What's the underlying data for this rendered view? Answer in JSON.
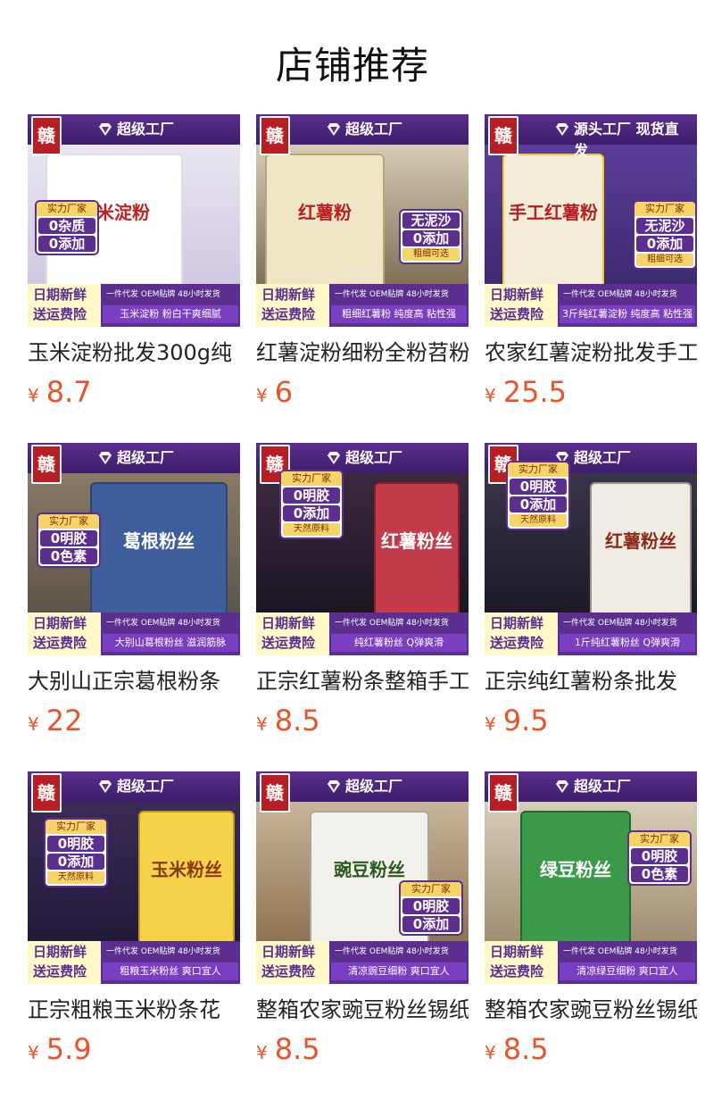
{
  "page": {
    "title": "店铺推荐"
  },
  "colors": {
    "accent": "#5b2e8f",
    "price": "#e8542a",
    "banner_yellow": "#f7d46a"
  },
  "common": {
    "factory_label": "超级工厂",
    "logo_text": "赣",
    "bottom_left_line1": "日期新鲜",
    "bottom_left_line2": "送运费险",
    "bottom_right_top": "一件代发 OEM贴牌 48小时发货",
    "currency": "¥"
  },
  "products": [
    {
      "title": "玉米淀粉批发300g纯",
      "price": "8.7",
      "tagline": "玉米淀粉 粉白干爽细腻",
      "badge_top": "实力厂家",
      "badge_lines": [
        "0杂质",
        "0添加"
      ],
      "badge_sub": "",
      "pkg_text": "玉米淀粉",
      "factory_label_override": ""
    },
    {
      "title": "红薯淀粉细粉全粉苕粉",
      "price": "6",
      "tagline": "粗细红薯粉 纯度高 粘性强",
      "badge_top": "",
      "badge_lines": [
        "无泥沙",
        "0添加"
      ],
      "badge_sub": "粗细可选",
      "pkg_text": "红薯粉",
      "factory_label_override": ""
    },
    {
      "title": "农家红薯淀粉批发手工",
      "price": "25.5",
      "tagline": "3斤纯红薯淀粉 纯度高 粘性强",
      "badge_top": "实力厂家",
      "badge_lines": [
        "无泥沙",
        "0添加"
      ],
      "badge_sub": "粗细可选",
      "pkg_text": "手工红薯粉",
      "factory_label_override": "源头工厂 现货直发"
    },
    {
      "title": "大别山正宗葛根粉条",
      "price": "22",
      "tagline": "大别山葛根粉丝 滋润筋脉",
      "badge_top": "实力厂家",
      "badge_lines": [
        "0明胶",
        "0色素"
      ],
      "badge_sub": "",
      "pkg_text": "葛根粉丝",
      "factory_label_override": ""
    },
    {
      "title": "正宗红薯粉条整箱手工",
      "price": "8.5",
      "tagline": "纯红薯粉丝 Q弹爽滑",
      "badge_top": "实力厂家",
      "badge_lines": [
        "0明胶",
        "0添加"
      ],
      "badge_sub": "天然原料",
      "pkg_text": "红薯粉丝",
      "factory_label_override": ""
    },
    {
      "title": "正宗纯红薯粉条批发",
      "price": "9.5",
      "tagline": "1斤纯红薯粉丝 Q弹爽滑",
      "badge_top": "实力厂家",
      "badge_lines": [
        "0明胶",
        "0添加"
      ],
      "badge_sub": "天然原料",
      "pkg_text": "红薯粉丝",
      "factory_label_override": ""
    },
    {
      "title": "正宗粗粮玉米粉条花",
      "price": "5.9",
      "tagline": "粗粮玉米粉丝 爽口宜人",
      "badge_top": "实力厂家",
      "badge_lines": [
        "0明胶",
        "0添加"
      ],
      "badge_sub": "天然原料",
      "pkg_text": "玉米粉丝",
      "factory_label_override": ""
    },
    {
      "title": "整箱农家豌豆粉丝锡纸",
      "price": "8.5",
      "tagline": "清凉豌豆细粉 爽口宜人",
      "badge_top": "实力厂家",
      "badge_lines": [
        "0明胶",
        "0添加"
      ],
      "badge_sub": "",
      "pkg_text": "豌豆粉丝",
      "factory_label_override": ""
    },
    {
      "title": "整箱农家豌豆粉丝锡纸",
      "price": "8.5",
      "tagline": "清凉绿豆细粉 爽口宜人",
      "badge_top": "实力厂家",
      "badge_lines": [
        "0明胶",
        "0色素"
      ],
      "badge_sub": "",
      "pkg_text": "绿豆粉丝",
      "factory_label_override": ""
    }
  ]
}
